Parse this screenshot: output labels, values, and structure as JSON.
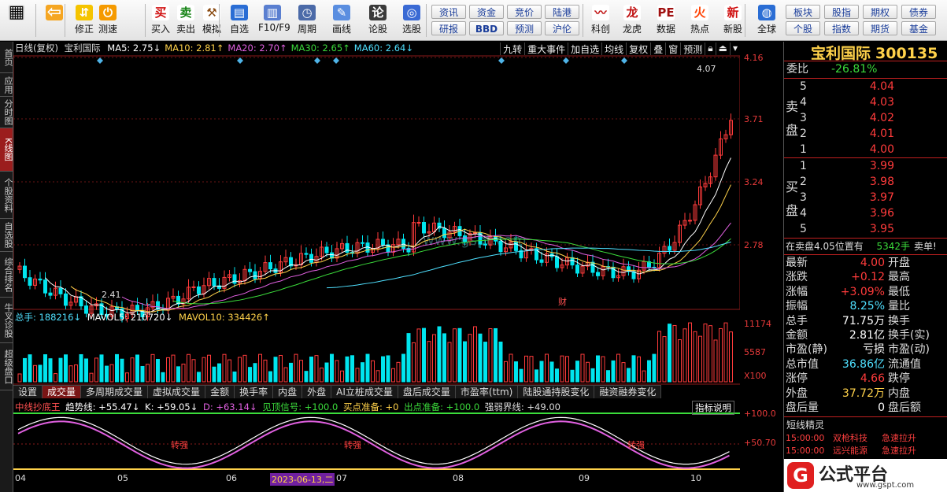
{
  "toolbar": {
    "groups": [
      {
        "label": "",
        "icon": "windows-icon"
      },
      {
        "label": "",
        "icon": "back-arrow-icon"
      },
      {
        "label": "修正",
        "icon": "up-down-icon"
      },
      {
        "label": "测速",
        "icon": "power-icon"
      },
      {
        "label": "买入",
        "icon": "buy-icon",
        "glyph": "买"
      },
      {
        "label": "卖出",
        "icon": "sell-icon",
        "glyph": "卖"
      },
      {
        "label": "模拟",
        "icon": "hammer-icon"
      },
      {
        "label": "自选",
        "icon": "favorites-icon"
      },
      {
        "label": "F10/F9",
        "icon": "f10-icon"
      },
      {
        "label": "周期",
        "icon": "clock-icon"
      },
      {
        "label": "画线",
        "icon": "pencil-icon"
      },
      {
        "label": "论股",
        "icon": "discuss-icon"
      },
      {
        "label": "选股",
        "icon": "search-stock-icon"
      },
      {
        "label": "科创",
        "icon": "chart-icon"
      },
      {
        "label": "龙虎",
        "icon": "dragon-icon"
      },
      {
        "label": "数据",
        "icon": "pe-icon"
      },
      {
        "label": "热点",
        "icon": "fire-icon"
      },
      {
        "label": "新股",
        "icon": "new-stock-icon"
      },
      {
        "label": "全球",
        "icon": "globe-icon"
      }
    ],
    "grid_left": [
      [
        "资讯",
        "资金",
        "竞价",
        "陆港"
      ],
      [
        "研报",
        "BBD",
        "预测",
        "沪伦"
      ]
    ],
    "grid_right": [
      [
        "板块",
        "股指",
        "期权",
        "债券"
      ],
      [
        "个股",
        "指数",
        "期货",
        "基金"
      ]
    ]
  },
  "left_tabs": [
    "首页",
    "应用",
    "分时图",
    "K线图",
    "个股资料",
    "自选股",
    "综合排名",
    "牛叉诊股",
    "超级盘口"
  ],
  "kline": {
    "period_label": "日线(复权)",
    "stock": "宝利国际",
    "ma": [
      {
        "t": "MA5: 2.75↓",
        "c": "#ffffff"
      },
      {
        "t": "MA10: 2.81↑",
        "c": "#ffd24a"
      },
      {
        "t": "MA20: 2.70↑",
        "c": "#e060e0"
      },
      {
        "t": "MA30: 2.65↑",
        "c": "#3bdc3b"
      },
      {
        "t": "MA60: 2.64↓",
        "c": "#4fe0ff"
      }
    ],
    "buttons": [
      "九转",
      "重大事件",
      "加自选",
      "均线",
      "复权",
      "叠",
      "窗",
      "预测"
    ],
    "high_label": "4.07",
    "low_label": "2.41",
    "marker_l": "L",
    "marker_cai": "财",
    "y_ticks": [
      "4.16",
      "3.71",
      "3.24",
      "2.78"
    ],
    "watermark": "www.gspt.com"
  },
  "volume": {
    "label": "总手: 188216↓",
    "mavol5": "MAVOL5: 210720↓",
    "mavol10": "MAVOL10: 334426↑",
    "y_ticks": [
      "11174",
      "5587",
      "X100"
    ]
  },
  "vol_tabs": [
    "设置",
    "成交量",
    "多周期成交量",
    "虚拟成交量",
    "金额",
    "换手率",
    "内盘",
    "外盘",
    "AI立桩成交量",
    "盘后成交量",
    "市盈率(ttm)",
    "陆股通持股变化",
    "融资融券变化"
  ],
  "indicator": {
    "name": "中线抄底王",
    "trend": "趋势线: +55.47↓",
    "k": "K: +59.05↓",
    "d": "D: +63.14↓",
    "top": "见顶信号: +100.0",
    "buy": "买点准备: +0",
    "sell": "出点准备: +100.0",
    "strong": "强弱界线: +49.00",
    "btn": "指标说明",
    "y_ticks": [
      "+100.0",
      "+50.70"
    ],
    "tag": "转强"
  },
  "xaxis": [
    "04",
    "05",
    "06",
    "2023-06-13,二",
    "07",
    "08",
    "09",
    "10"
  ],
  "quote": {
    "name": "宝利国际",
    "code": "300135",
    "weibi_label": "委比",
    "weibi": "-26.81%",
    "sell_label": "卖盘",
    "buy_label": "买盘",
    "sells": [
      [
        "5",
        "4.04"
      ],
      [
        "4",
        "4.03"
      ],
      [
        "3",
        "4.02"
      ],
      [
        "2",
        "4.01"
      ],
      [
        "1",
        "4.00"
      ]
    ],
    "buys": [
      [
        "1",
        "3.99"
      ],
      [
        "2",
        "3.98"
      ],
      [
        "3",
        "3.97"
      ],
      [
        "4",
        "3.96"
      ],
      [
        "5",
        "3.95"
      ]
    ],
    "alert": "在卖盘4.05位置有",
    "alert_qty": "5342手",
    "alert_tag": "卖单!",
    "stats": [
      [
        "最新",
        "4.00",
        "开盘",
        ""
      ],
      [
        "涨跌",
        "+0.12",
        "最高",
        ""
      ],
      [
        "涨幅",
        "+3.09%",
        "最低",
        ""
      ],
      [
        "振幅",
        "8.25%",
        "量比",
        ""
      ],
      [
        "总手",
        "71.75万",
        "换手",
        ""
      ],
      [
        "金额",
        "2.81亿",
        "换手(实)",
        ""
      ],
      [
        "市盈(静)",
        "亏损",
        "市盈(动)",
        ""
      ],
      [
        "总市值",
        "36.86亿",
        "流通值",
        ""
      ],
      [
        "涨停",
        "4.66",
        "跌停",
        ""
      ],
      [
        "外盘",
        "37.72万",
        "内盘",
        ""
      ],
      [
        "盘后量",
        "0",
        "盘后额",
        ""
      ]
    ],
    "short_title": "短线精灵",
    "short_rows": [
      [
        "15:00:00",
        "双枪科技",
        "急速拉升"
      ],
      [
        "15:00:00",
        "远兴能源",
        "急速拉升"
      ]
    ]
  },
  "logo": {
    "text": "公式平台",
    "url": "www.gspt.com"
  },
  "colors": {
    "up": "#ff3b3b",
    "down": "#00e5ee",
    "accent": "#c02020"
  }
}
